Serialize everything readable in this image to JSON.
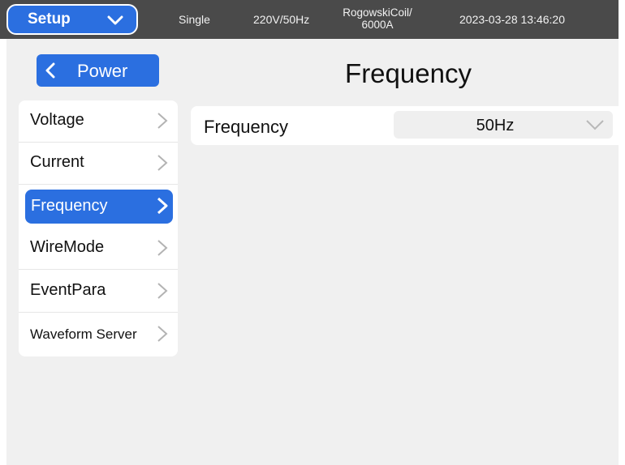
{
  "topbar": {
    "setup_label": "Setup",
    "mode": "Single",
    "voltage": "220V/50Hz",
    "sensor_line1": "RogowskiCoil/",
    "sensor_line2": "6000A",
    "datetime": "2023-03-28 13:46:20"
  },
  "back_label": "Power",
  "page_title": "Frequency",
  "nav": {
    "items": [
      {
        "label": "Voltage"
      },
      {
        "label": "Current"
      },
      {
        "label": "Frequency",
        "active": true
      },
      {
        "label": "WireMode"
      },
      {
        "label": "EventPara"
      },
      {
        "label": "Waveform Server"
      }
    ]
  },
  "setting": {
    "label": "Frequency",
    "value": "50Hz"
  },
  "icons": {
    "setup": "chevron-down-icon",
    "back": "chevron-left-icon",
    "nav": "chevron-right-icon",
    "select": "chevron-down-icon"
  },
  "colors": {
    "accent": "#2b6fe0",
    "topbar": "#4a4a4a",
    "background": "#f0f0f0"
  }
}
